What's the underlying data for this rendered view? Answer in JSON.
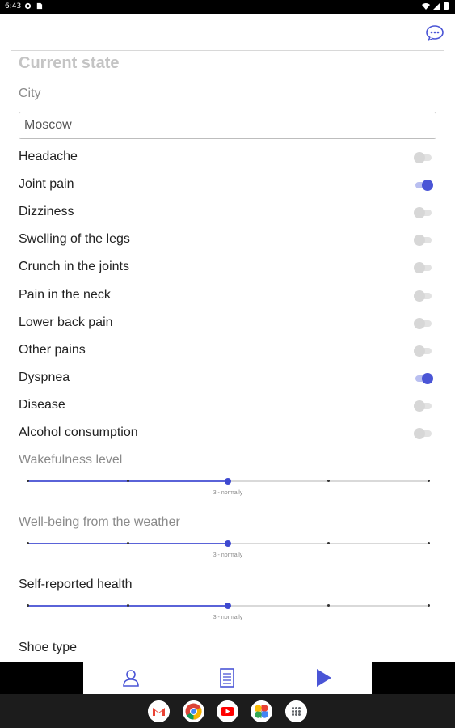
{
  "status_bar": {
    "time": "6:43"
  },
  "page": {
    "title": "Current state",
    "city_label": "City",
    "city_value": "Moscow"
  },
  "symptoms": [
    {
      "label": "Headache",
      "on": false
    },
    {
      "label": "Joint pain",
      "on": true
    },
    {
      "label": "Dizziness",
      "on": false
    },
    {
      "label": "Swelling of the legs",
      "on": false
    },
    {
      "label": "Crunch in the joints",
      "on": false
    },
    {
      "label": "Pain in the neck",
      "on": false
    },
    {
      "label": "Lower back pain",
      "on": false
    },
    {
      "label": "Other pains",
      "on": false
    },
    {
      "label": "Dyspnea",
      "on": true
    },
    {
      "label": "Disease",
      "on": false
    },
    {
      "label": "Alcohol consumption",
      "on": false
    }
  ],
  "sliders": [
    {
      "label": "Wakefulness level",
      "value": 3,
      "min": 1,
      "max": 5,
      "caption": "3 - normally"
    },
    {
      "label": "Well-being from the weather",
      "value": 3,
      "min": 1,
      "max": 5,
      "caption": "3 - normally"
    },
    {
      "label": "Self-reported health",
      "value": 3,
      "min": 1,
      "max": 5,
      "caption": "3 - normally"
    }
  ],
  "shoe_type_label": "Shoe type",
  "nav": {
    "items": [
      "profile-icon",
      "document-icon",
      "play-icon"
    ]
  },
  "dock": {
    "apps": [
      "gmail-icon",
      "chrome-icon",
      "youtube-icon",
      "photos-icon",
      "app-drawer-icon"
    ]
  },
  "colors": {
    "accent": "#4a55d6",
    "switch_off": "#d7d7d7",
    "title": "#c4c4c4"
  }
}
